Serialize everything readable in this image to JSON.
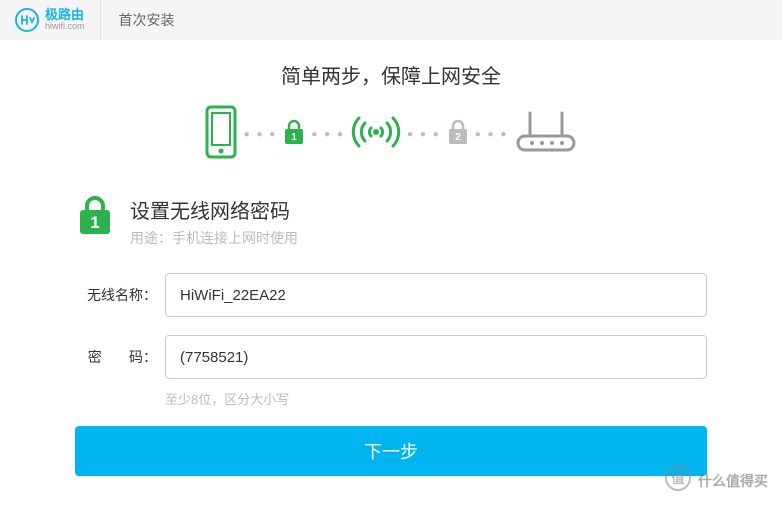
{
  "header": {
    "brand": "极路由",
    "sub": "hiwifi.com",
    "title": "首次安装"
  },
  "headline": "简单两步，保障上网安全",
  "step": {
    "number": "1",
    "title": "设置无线网络密码",
    "desc": "用途：手机连接上网时使用"
  },
  "form": {
    "ssid_label": "无线名称：",
    "ssid_value": "HiWiFi_22EA22",
    "pwd_label": "密",
    "pwd_label2": "码：",
    "pwd_value": "(7758521)",
    "pwd_hint": "至少8位，区分大小写",
    "submit": "下一步"
  },
  "watermark": "什么值得买"
}
